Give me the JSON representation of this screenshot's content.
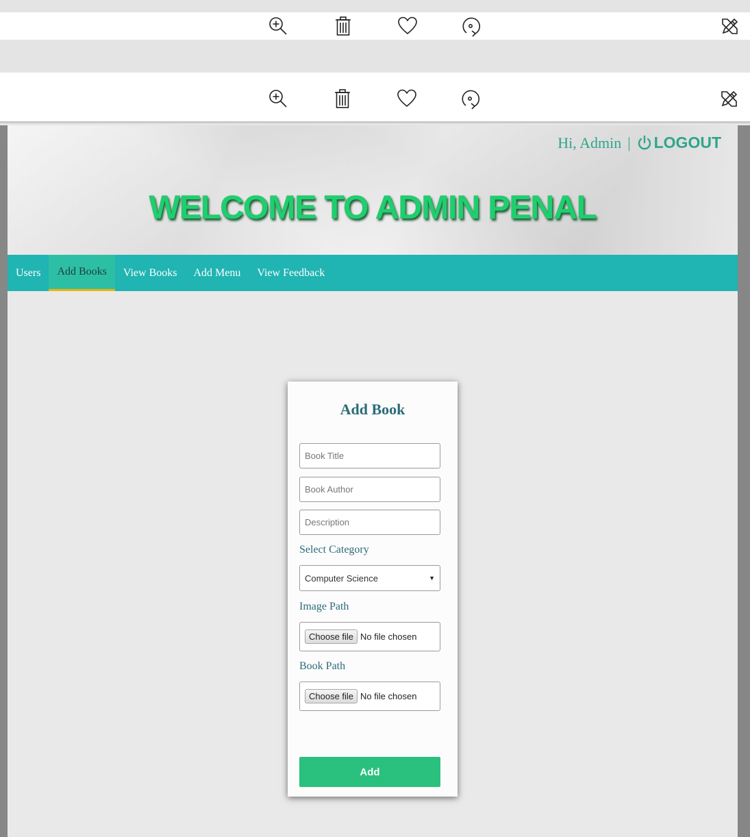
{
  "viewer": {
    "toolbar_icons": [
      "zoom-in-icon",
      "delete-icon",
      "favorite-icon",
      "rotate-icon",
      "edit-icon"
    ]
  },
  "header": {
    "greeting": "Hi, Admin",
    "separator": "|",
    "logout_label": "LOGOUT",
    "welcome_title": "WELCOME TO ADMIN PENAL"
  },
  "nav": {
    "items": [
      "Users",
      "Add Books",
      "View Books",
      "Add Menu",
      "View Feedback"
    ],
    "active": "Add Books"
  },
  "form": {
    "title": "Add Book",
    "book_title_placeholder": "Book Title",
    "book_author_placeholder": "Book Author",
    "description_placeholder": "Description",
    "category_label": "Select Category",
    "category_selected": "Computer Science",
    "image_path_label": "Image Path",
    "book_path_label": "Book Path",
    "choose_file_label": "Choose file",
    "no_file_text": "No file chosen",
    "submit_label": "Add"
  },
  "colors": {
    "nav_bg": "#20b4b2",
    "accent_green": "#29c17d",
    "label_teal": "#2a6c78",
    "active_underline": "#f0b400"
  }
}
